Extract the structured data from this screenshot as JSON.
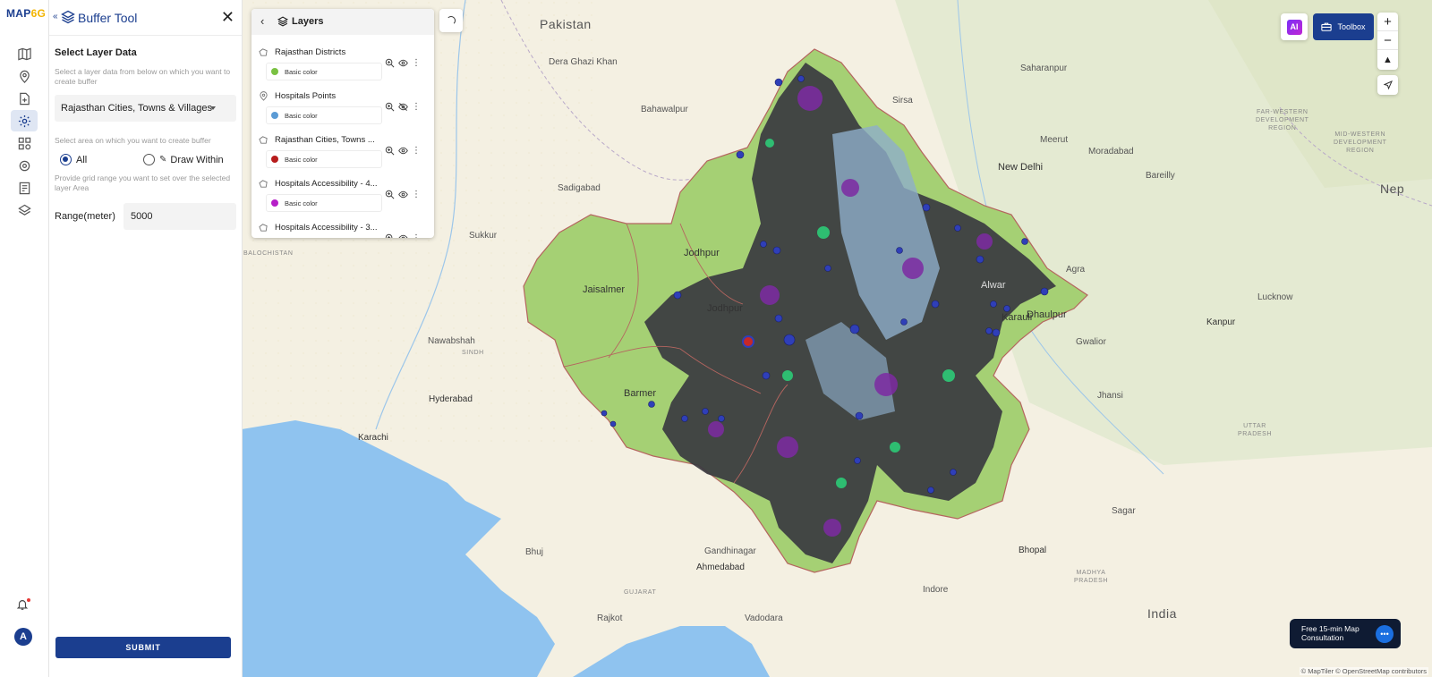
{
  "app": {
    "logo_main": "MAP",
    "logo_accent": "6G"
  },
  "rail": {
    "items": [
      {
        "icon": "map-icon"
      },
      {
        "icon": "location-pin-icon"
      },
      {
        "icon": "add-file-icon"
      },
      {
        "icon": "gear-icon"
      },
      {
        "icon": "dashboard-icon"
      },
      {
        "icon": "settings-icon"
      },
      {
        "icon": "report-icon"
      },
      {
        "icon": "map-data-icon"
      }
    ],
    "avatar_initial": "A"
  },
  "buffer_tool": {
    "title": "Buffer Tool",
    "close": "✕",
    "select_layer_title": "Select Layer Data",
    "select_layer_hint": "Select a layer data from below on which you want to create buffer",
    "selected_layer": "Rajasthan Cities, Towns & Villages",
    "area_hint": "Select area on which you want to create buffer",
    "radio_all": "All",
    "radio_draw": "Draw Within",
    "grid_hint": "Provide grid range you want to set over the selected layer Area",
    "range_label": "Range(meter)",
    "range_value": "5000",
    "submit": "SUBMIT"
  },
  "layers": {
    "title": "Layers",
    "items": [
      {
        "name": "Rajasthan Districts",
        "color_label": "Basic color",
        "color": "#7ac142",
        "icon": "polygon-icon"
      },
      {
        "name": "Hospitals Points",
        "color_label": "Basic color",
        "color": "#5b9bd5",
        "icon": "point-icon"
      },
      {
        "name": "Rajasthan Cities, Towns ...",
        "color_label": "Basic color",
        "color": "#b71c1c",
        "icon": "polygon-icon"
      },
      {
        "name": "Hospitals Accessibility - 4...",
        "color_label": "Basic color",
        "color": "#b620c8",
        "icon": "polygon-icon"
      },
      {
        "name": "Hospitals Accessibility - 3...",
        "color_label": "",
        "color": "",
        "icon": "polygon-icon"
      }
    ]
  },
  "map": {
    "labels": {
      "pakistan": "Pakistan",
      "india": "India",
      "nepal": "Nep",
      "balochistan": "BALOCHISTAN",
      "sindh": "SINDH",
      "gujarat": "GUJARAT",
      "madhya_pradesh": "MADHYA\nPRADESH",
      "uttar_pradesh": "UTTAR\nPRADESH",
      "far_western": "FAR-WESTERN\nDEVELOPMENT\nREGION",
      "mid_western": "MID-WESTERN\nDEVELOPMENT\nREGION",
      "new_delhi": "New Delhi",
      "karachi": "Karachi",
      "hyderabad": "Hyderabad",
      "ahmedabad": "Ahmedabad",
      "bhopal": "Bhopal",
      "kanpur": "Kanpur",
      "lucknow": "Lucknow",
      "indore": "Indore",
      "jhansi": "Jhansi",
      "dera_ghazi_khan": "Dera Ghazi Khan",
      "bahawalpur": "Bahawalpur",
      "sadigabad": "Sadigabad",
      "sukkur": "Sukkur",
      "nawabshah": "Nawabshah",
      "sirsa": "Sirsa",
      "saharanpur": "Saharanpur",
      "meerut": "Meerut",
      "moradabad": "Moradabad",
      "bareilly": "Bareilly",
      "agra": "Agra",
      "gwalior": "Gwalior",
      "bhuj": "Bhuj",
      "rajkot": "Rajkot",
      "vadodara": "Vadodara",
      "gandhinagar": "Gandhinagar",
      "sagar": "Sagar",
      "jaisalmer": "Jaisalmer",
      "barmer": "Barmer",
      "jodhpur": "Jodhpur",
      "jodhpur2": "Jodhpur",
      "karauli": "Karauli",
      "dhaulpur": "Dhaulpur",
      "alwar": "Alwar"
    }
  },
  "controls": {
    "toolbox": "Toolbox",
    "ai": "AI",
    "zoom_in": "+",
    "zoom_out": "−",
    "compass": "▲",
    "consult_line1": "Free 15-min Map",
    "consult_line2": "Consultation",
    "attribution": "© MapTiler © OpenStreetMap contributors"
  }
}
